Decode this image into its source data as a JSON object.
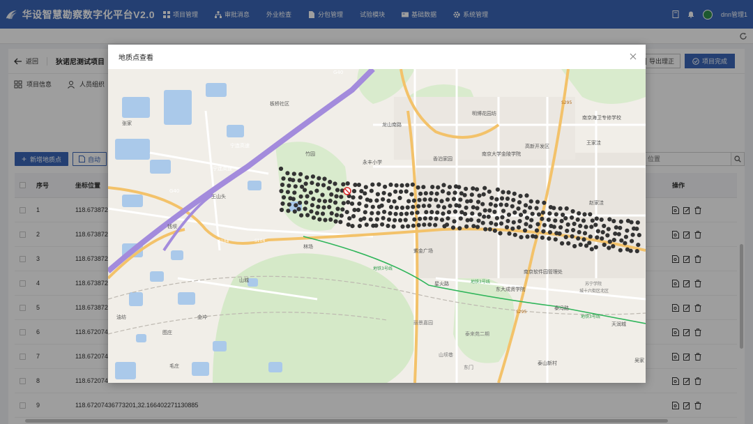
{
  "app": {
    "title": "华设智慧勘察数字化平台V2.0",
    "menu": [
      {
        "label": "项目管理",
        "icon": "grid-icon"
      },
      {
        "label": "审批消息",
        "icon": "network-icon"
      },
      {
        "label": "外业检查",
        "icon": ""
      },
      {
        "label": "分包管理",
        "icon": "file-icon"
      },
      {
        "label": "试验模块",
        "icon": ""
      },
      {
        "label": "基础数据",
        "icon": "card-icon"
      },
      {
        "label": "系统管理",
        "icon": "gear-icon"
      }
    ],
    "user": "dnn管理1"
  },
  "page": {
    "back_label": "返回",
    "project_title": "狄诺尼测试项目",
    "export_label": "导出理正",
    "complete_label": "项目完成",
    "tabs": [
      {
        "label": "项目信息",
        "icon": "grid-icon"
      },
      {
        "label": "人员组织",
        "icon": "user-icon"
      }
    ],
    "add_button": "新增地质点",
    "auto_button": "自动",
    "search_placeholder": "位置"
  },
  "table": {
    "headers": {
      "no": "序号",
      "coord": "坐标位置",
      "op": "操作"
    },
    "rows": [
      {
        "no": "1",
        "coord": "118.673872"
      },
      {
        "no": "2",
        "coord": "118.673872"
      },
      {
        "no": "3",
        "coord": "118.673872"
      },
      {
        "no": "4",
        "coord": "118.673872"
      },
      {
        "no": "5",
        "coord": "118.673872"
      },
      {
        "no": "6",
        "coord": "118.672074"
      },
      {
        "no": "7",
        "coord": "118.672074"
      },
      {
        "no": "8",
        "coord": "118.672074"
      },
      {
        "no": "9",
        "coord": "118.67207436773201,32.166402271130885"
      }
    ]
  },
  "dialog": {
    "title": "地质点查看"
  },
  "map": {
    "labels": [
      {
        "text": "G40"
      },
      {
        "text": "板桥社区"
      },
      {
        "text": "宁连高速"
      },
      {
        "text": "宁连高速"
      },
      {
        "text": "龙山南路"
      },
      {
        "text": "永丰小学"
      },
      {
        "text": "竹园"
      },
      {
        "text": "王山头"
      },
      {
        "text": "钱坝"
      },
      {
        "text": "G40"
      },
      {
        "text": "S104"
      },
      {
        "text": "S104"
      },
      {
        "text": "林场"
      },
      {
        "text": "地铁3号线"
      },
      {
        "text": "地铁3号线"
      },
      {
        "text": "地铁3号线"
      },
      {
        "text": "紫金广场"
      },
      {
        "text": "星火路"
      },
      {
        "text": "东大成贤学院"
      },
      {
        "text": "泰冯路"
      },
      {
        "text": "南京软件园管理处"
      },
      {
        "text": "苏宁学院"
      },
      {
        "text": "城十六街区北区"
      },
      {
        "text": "天润城"
      },
      {
        "text": "泰山新村"
      },
      {
        "text": "泰来苑二期"
      },
      {
        "text": "丽景嘉园"
      },
      {
        "text": "山坝巷"
      },
      {
        "text": "东门"
      },
      {
        "text": "山城"
      },
      {
        "text": "金冲"
      },
      {
        "text": "油坊"
      },
      {
        "text": "图庄"
      },
      {
        "text": "毛庄"
      },
      {
        "text": "南京大学金陵学院"
      },
      {
        "text": "高新开发区"
      },
      {
        "text": "南京海卫专修学校"
      },
      {
        "text": "香泊家园"
      },
      {
        "text": "明博花园坊"
      },
      {
        "text": "王家洼"
      },
      {
        "text": "赵家洼"
      },
      {
        "text": "张家"
      },
      {
        "text": "S295"
      },
      {
        "text": "S295"
      },
      {
        "text": "吴家"
      }
    ]
  },
  "colors": {
    "nav": "#3a67b8",
    "accent": "#3a67b8",
    "marker": "#333333",
    "metro": "#2fb55a",
    "expressway": "#9b7fd6",
    "highway": "#f3b04a"
  }
}
